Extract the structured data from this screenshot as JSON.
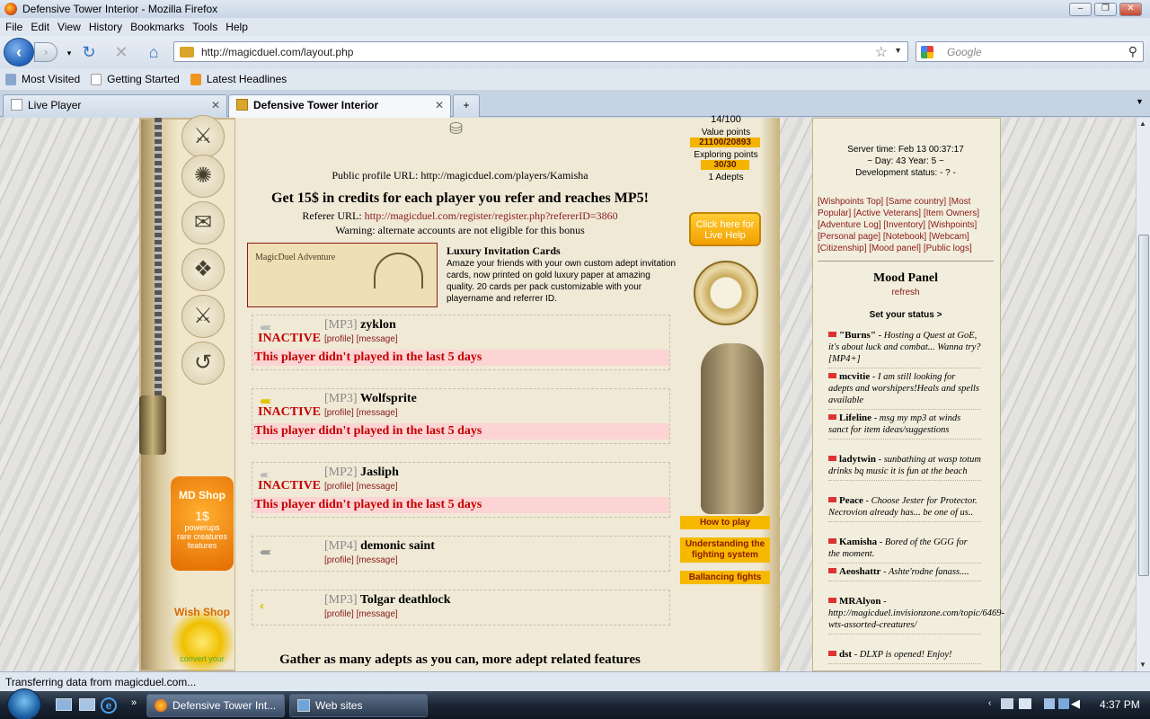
{
  "window": {
    "title": "Defensive Tower Interior - Mozilla Firefox"
  },
  "menu": [
    "File",
    "Edit",
    "View",
    "History",
    "Bookmarks",
    "Tools",
    "Help"
  ],
  "nav": {
    "url": "http://magicduel.com/layout.php",
    "search_placeholder": "Google"
  },
  "bookmarks": [
    "Most Visited",
    "Getting Started",
    "Latest Headlines"
  ],
  "tabs": [
    {
      "label": "Live Player"
    },
    {
      "label": "Defensive Tower Interior"
    }
  ],
  "left": {
    "shop_label": "MD Shop",
    "shop_price": "1$",
    "shop_lines": [
      "powerups",
      "rare creatures",
      "features"
    ],
    "wish_label": "Wish Shop",
    "wish_sub": "convert your"
  },
  "main": {
    "public_profile": "Public profile URL: http://magicduel.com/players/Kamisha",
    "credits": "Get 15$ in credits for each player you refer and reaches MP5!",
    "referer_label": "Referer URL:",
    "referer_url": "http://magicduel.com/register/register.php?refererID=3860",
    "warning": "Warning: alternate accounts are not eligible for this bonus",
    "card_title": "MagicDuel Adventure",
    "lux_title": "Luxury Invitation Cards",
    "lux_text": "Amaze your friends with your own custom adept invitation cards, now printed on gold luxury paper at amazing quality. 20 cards per pack customizable with your playername and referrer ID.",
    "players": [
      {
        "mp": "[MP3]",
        "name": "zyklon",
        "inactive": "INACTIVE",
        "profile": "[profile]",
        "message": "[message]",
        "notice": "This player didn't played in the last 5 days"
      },
      {
        "mp": "[MP3]",
        "name": "Wolfsprite",
        "inactive": "INACTIVE",
        "profile": "[profile]",
        "message": "[message]",
        "notice": "This player didn't played in the last 5 days"
      },
      {
        "mp": "[MP2]",
        "name": "Jasliph",
        "inactive": "INACTIVE",
        "profile": "[profile]",
        "message": "[message]",
        "notice": "This player didn't played in the last 5 days"
      },
      {
        "mp": "[MP4]",
        "name": "demonic saint",
        "profile": "[profile]",
        "message": "[message]"
      },
      {
        "mp": "[MP3]",
        "name": "Tolgar deathlock",
        "profile": "[profile]",
        "message": "[message]"
      }
    ],
    "footer": "Gather as many adepts as you can, more adept related features"
  },
  "mid": {
    "count": "14/100",
    "value_label": "Value points",
    "value": "21100/20893",
    "explore_label": "Exploring points",
    "explore": "30/30",
    "adepts": "1  Adepts",
    "live_help": "Click here for Live Help",
    "how_to_play": "How to play",
    "understanding": "Understanding the fighting system",
    "balancing": "Ballancing fights"
  },
  "right": {
    "server_time": "Server time: Feb 13 00:37:17",
    "day": "~ Day: 43 Year: 5 ~",
    "dev_status": "Development status: - ? -",
    "links": "[Wishpoints Top] [Same country] [Most Popular] [Active Veterans] [Item Owners] [Adventure Log] [Inventory] [Wishpoints] [Personal page] [Notebook] [Webcam] [Citizenship] [Mood panel] [Public logs]",
    "mood_title": "Mood Panel",
    "refresh": "refresh",
    "set_status": "Set your status >",
    "moods": [
      {
        "name": "\"Burns\"",
        "text": " - Hosting a Quest at GoE, it's about luck and combat... Wanna try?[MP4+]"
      },
      {
        "name": "mcvitie",
        "text": " - I am still looking for adepts and worshipers!Heals and spells available"
      },
      {
        "name": "Lifeline",
        "text": " - msg my mp3 at winds sanct for item ideas/suggestions"
      },
      {
        "name": "ladytwin",
        "text": " - sunbathing at wasp totum drinks bq music it is fun at the beach"
      },
      {
        "name": "Peace",
        "text": " - Choose Jester for Protector. Necrovion already has... be one of us.."
      },
      {
        "name": "Kamisha",
        "text": " - Bored of the GGG for the moment."
      },
      {
        "name": "Aeoshattr",
        "text": " - Ashte'rodne fanass...."
      },
      {
        "name": "MRAlyon",
        "text": " - http://magicduel.invisionzone.com/topic/6469-wts-assorted-creatures/"
      },
      {
        "name": "dst",
        "text": " - DLXP is opened! Enjoy!"
      }
    ]
  },
  "status": "Transferring data from magicduel.com...",
  "taskbar": {
    "items": [
      "Defensive Tower Int...",
      "Web sites"
    ],
    "time": "4:37 PM"
  }
}
